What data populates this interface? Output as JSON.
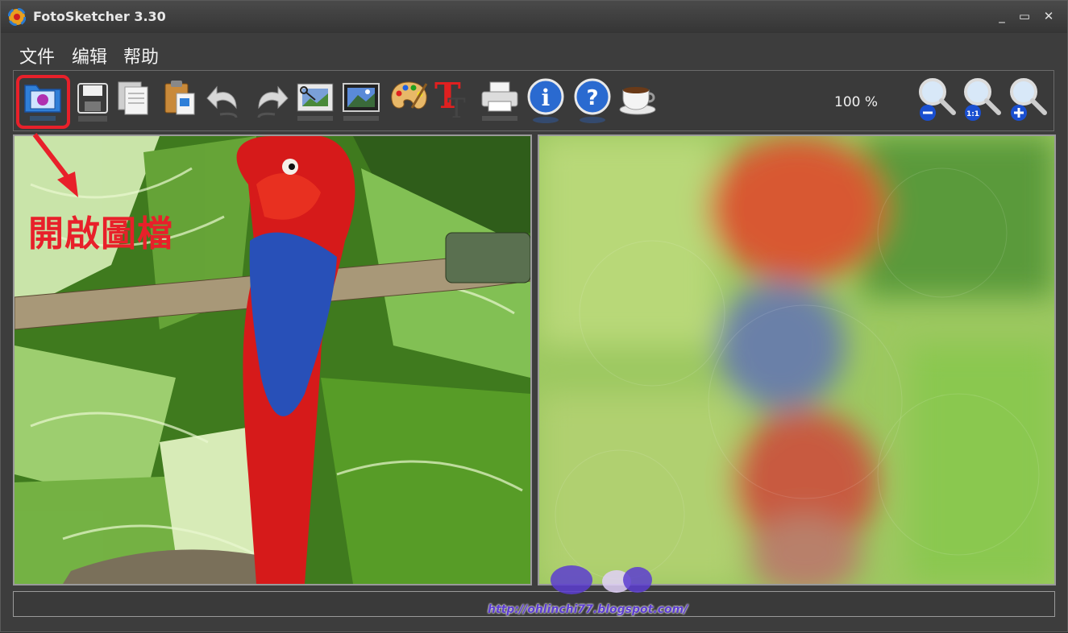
{
  "window": {
    "title": "FotoSketcher 3.30",
    "minimize": "_",
    "maximize": "▭",
    "close": "✕"
  },
  "menu": {
    "items": [
      "文件",
      "编辑",
      "帮助"
    ]
  },
  "toolbar": {
    "tools": [
      {
        "name": "open-image",
        "icon": "open-folder-icon"
      },
      {
        "name": "save",
        "icon": "floppy-disk-icon"
      },
      {
        "name": "copy",
        "icon": "copy-icon"
      },
      {
        "name": "paste",
        "icon": "clipboard-paste-icon"
      },
      {
        "name": "undo",
        "icon": "undo-arrow-icon"
      },
      {
        "name": "redo",
        "icon": "redo-arrow-icon"
      },
      {
        "name": "crop",
        "icon": "scissors-film-icon"
      },
      {
        "name": "frame",
        "icon": "picture-frame-icon"
      },
      {
        "name": "palette",
        "icon": "paint-palette-icon"
      },
      {
        "name": "text",
        "icon": "text-T-icon"
      },
      {
        "name": "print",
        "icon": "printer-icon"
      },
      {
        "name": "info",
        "icon": "info-icon"
      },
      {
        "name": "help",
        "icon": "help-icon"
      },
      {
        "name": "coffee",
        "icon": "coffee-cup-icon"
      }
    ],
    "zoom_level": "100 %",
    "zoom_buttons": [
      {
        "name": "zoom-out",
        "icon": "zoom-out-icon",
        "sign": "−"
      },
      {
        "name": "zoom-fit",
        "icon": "zoom-fit-icon",
        "sign": "1:1"
      },
      {
        "name": "zoom-in",
        "icon": "zoom-in-icon",
        "sign": "+"
      }
    ]
  },
  "annotation": {
    "text": "開啟圖檔",
    "color": "#e8202a"
  },
  "watermark": {
    "url": "http://ohlinchi77.blogspot.com/"
  },
  "colors": {
    "window_bg": "#3d3d3d",
    "accent_red": "#e8202a",
    "border": "#9a9a9a"
  }
}
